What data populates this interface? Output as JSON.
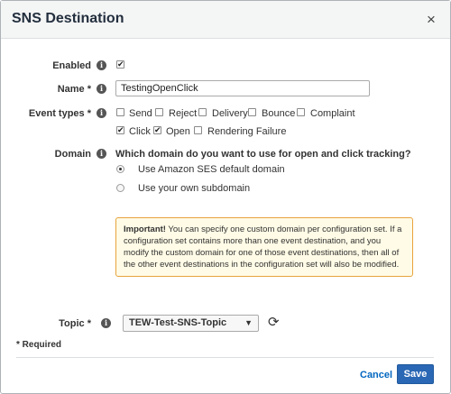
{
  "dialog": {
    "title": "SNS Destination",
    "close_glyph": "×"
  },
  "form": {
    "enabled": {
      "label": "Enabled",
      "checked": true
    },
    "name": {
      "label": "Name *",
      "value": "TestingOpenClick"
    },
    "event_types": {
      "label": "Event types *",
      "options": [
        {
          "label": "Send",
          "checked": false
        },
        {
          "label": "Reject",
          "checked": false
        },
        {
          "label": "Delivery",
          "checked": false
        },
        {
          "label": "Bounce",
          "checked": false
        },
        {
          "label": "Complaint",
          "checked": false
        },
        {
          "label": "Click",
          "checked": true
        },
        {
          "label": "Open",
          "checked": true
        },
        {
          "label": "Rendering Failure",
          "checked": false
        }
      ]
    },
    "domain": {
      "label": "Domain",
      "question": "Which domain do you want to use for open and click tracking?",
      "options": [
        {
          "label": "Use Amazon SES default domain",
          "selected": true
        },
        {
          "label": "Use your own subdomain",
          "selected": false
        }
      ]
    },
    "alert": {
      "strong": "Important!",
      "text": " You can specify one custom domain per configuration set. If a configuration set contains more than one event destination, and you modify the custom domain for one of those event destinations, then all of the other event destinations in the configuration set will also be modified."
    },
    "topic": {
      "label": "Topic *",
      "value": "TEW-Test-SNS-Topic"
    },
    "required_note": "* Required"
  },
  "footer": {
    "cancel_label": "Cancel",
    "save_label": "Save"
  },
  "colors": {
    "primary": "#2a67b4",
    "link": "#0066c0",
    "alert_border": "#e8a33d",
    "alert_bg": "#fffbe6"
  },
  "icons": [
    "info-icon",
    "close-icon",
    "refresh-icon",
    "chevron-down-icon"
  ]
}
